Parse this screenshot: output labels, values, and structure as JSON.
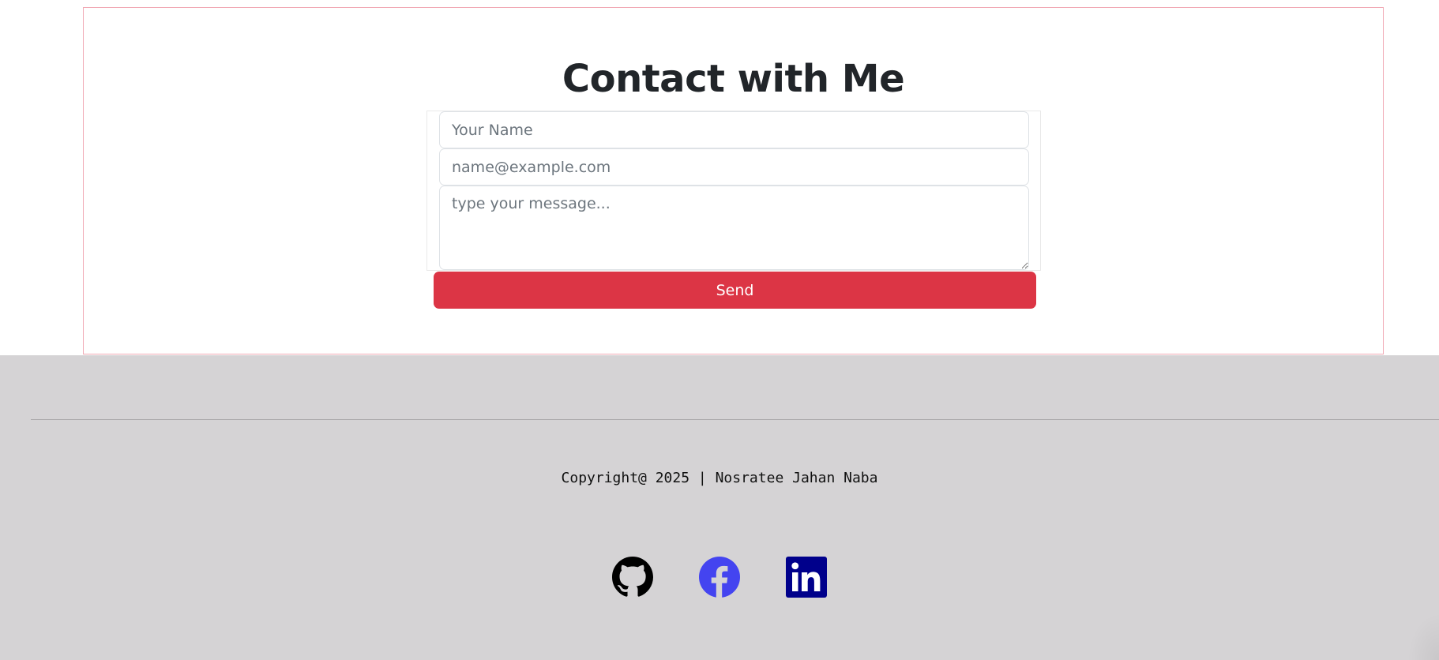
{
  "contact": {
    "title": "Contact with Me",
    "name_placeholder": "Your Name",
    "email_placeholder": "name@example.com",
    "message_placeholder": "type your message...",
    "send_label": "Send"
  },
  "footer": {
    "copyright": "Copyright@ 2025 | Nosratee Jahan Naba",
    "social": [
      {
        "icon": "github-icon",
        "color": "#000000"
      },
      {
        "icon": "facebook-icon",
        "color": "#4444f0"
      },
      {
        "icon": "linkedin-icon",
        "color": "#00008b"
      }
    ]
  },
  "colors": {
    "accent": "#dc3545",
    "section_border": "#f1aab5",
    "footer_bg": "#d5d3d5"
  }
}
